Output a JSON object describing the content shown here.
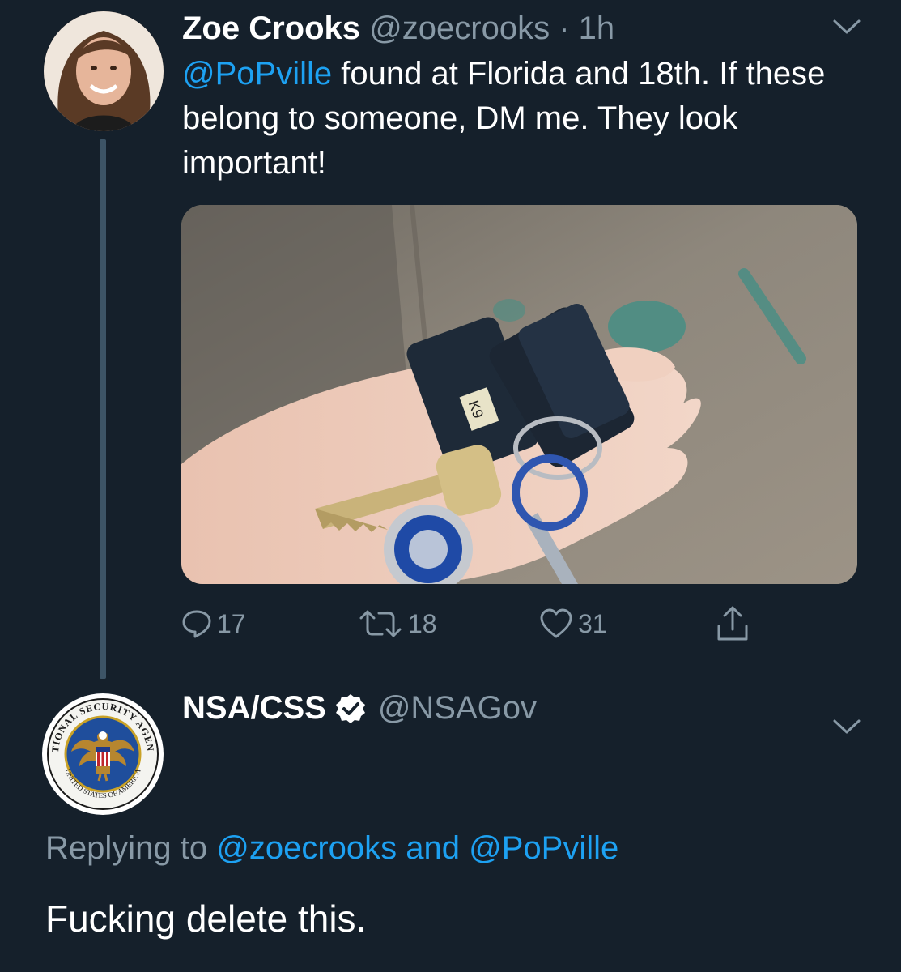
{
  "colors": {
    "background": "#15202b",
    "text": "#ffffff",
    "secondary_text": "#8899a6",
    "link": "#1da1f2",
    "thread_line": "#3d5466"
  },
  "tweet": {
    "author": {
      "display_name": "Zoe Crooks",
      "handle": "@zoecrooks",
      "separator": "·",
      "time": "1h"
    },
    "text": {
      "mention": "@PoPville",
      "body": " found at Florida and 18th. If these belong to someone, DM me. They look important!"
    },
    "media": {
      "label_on_fob": "K9"
    },
    "actions": {
      "replies": "17",
      "retweets": "18",
      "likes": "31"
    },
    "icons": {
      "menu": "chevron-down-icon",
      "reply": "speech-bubble-icon",
      "retweet": "retweet-arrows-icon",
      "like": "heart-icon",
      "share": "share-arrow-icon"
    }
  },
  "reply": {
    "author": {
      "display_name": "NSA/CSS",
      "handle": "@NSAGov",
      "verified": true,
      "seal_top_text": "NATIONAL SECURITY AGENCY",
      "seal_bottom_text": "UNITED STATES OF AMERICA"
    },
    "replying_to": {
      "prefix": "Replying to ",
      "first": "@zoecrooks",
      "connector": " and ",
      "second": "@PoPville"
    },
    "text": "Fucking delete this."
  }
}
